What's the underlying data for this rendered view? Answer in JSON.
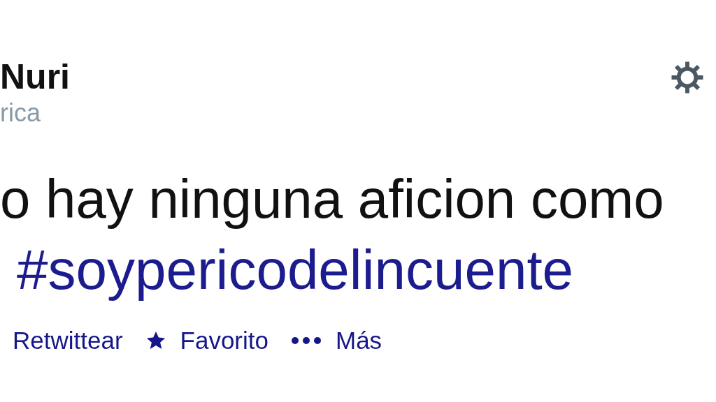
{
  "tweet": {
    "author_name": "Nuri",
    "author_detail": "rica",
    "text": "o hay ninguna aficion como",
    "hashtag": "#soypericodelincuente",
    "actions": [
      {
        "label": "Retwittear",
        "kind": "retweet"
      },
      {
        "label": "Favorito",
        "kind": "favorite"
      },
      {
        "label": "Más",
        "kind": "more"
      }
    ]
  }
}
